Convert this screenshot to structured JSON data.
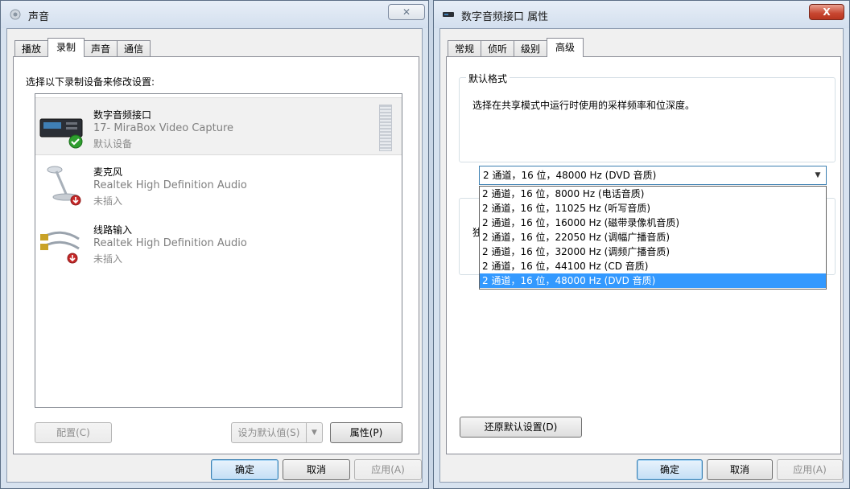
{
  "left_window": {
    "title": "声音",
    "close": "✕",
    "tabs": [
      "播放",
      "录制",
      "声音",
      "通信"
    ],
    "instruction": "选择以下录制设备来修改设置:",
    "devices": [
      {
        "name": "数字音频接口",
        "desc": "17- MiraBox Video Capture",
        "status": "默认设备",
        "status_icon": "green-check-icon"
      },
      {
        "name": "麦克风",
        "desc": "Realtek High Definition Audio",
        "status": "未插入",
        "status_icon": "red-down-arrow-icon"
      },
      {
        "name": "线路输入",
        "desc": "Realtek High Definition Audio",
        "status": "未插入",
        "status_icon": "red-down-arrow-icon"
      }
    ],
    "buttons": {
      "configure": "配置(C)",
      "set_default": "设为默认值(S)",
      "properties": "属性(P)",
      "ok": "确定",
      "cancel": "取消",
      "apply": "应用(A)"
    }
  },
  "right_window": {
    "title": "数字音频接口 属性",
    "close": "X",
    "tabs": [
      "常规",
      "侦听",
      "级别",
      "高级"
    ],
    "group_label": "默认格式",
    "group_desc": "选择在共享模式中运行时使用的采样频率和位深度。",
    "combo_value": "2 通道，16 位，48000 Hz (DVD 音质)",
    "options": [
      "2 通道，16 位，8000 Hz (电话音质)",
      "2 通道，16 位，11025 Hz (听写音质)",
      "2 通道，16 位，16000 Hz (磁带录像机音质)",
      "2 通道，16 位，22050 Hz (调幅广播音质)",
      "2 通道，16 位，32000 Hz (调频广播音质)",
      "2 通道，16 位，44100 Hz (CD 音质)",
      "2 通道，16 位，48000 Hz (DVD 音质)"
    ],
    "truncated_label": "独",
    "buttons": {
      "restore": "还原默认设置(D)",
      "ok": "确定",
      "cancel": "取消",
      "apply": "应用(A)"
    }
  },
  "colors": {
    "selection": "#3399ff",
    "window_frame": "#d7e2ef",
    "check_green": "#2e9e2e",
    "unplugged_red": "#c62828"
  }
}
